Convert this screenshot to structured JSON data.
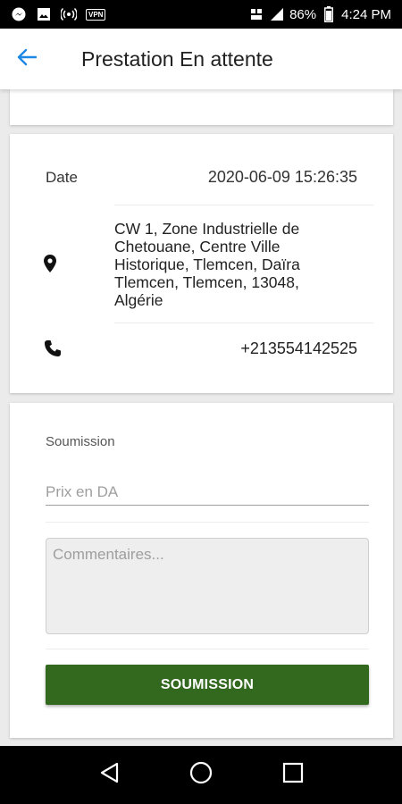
{
  "status_bar": {
    "battery": "86%",
    "time": "4:24 PM",
    "vpn_label": "VPN",
    "icons": [
      "messenger-icon",
      "image-icon",
      "hotspot-icon",
      "vpn-icon",
      "network-icon",
      "signal-icon",
      "battery-icon"
    ]
  },
  "app_bar": {
    "title": "Prestation En attente",
    "back_icon": "arrow-left-icon",
    "accent_color": "#1e88e5"
  },
  "info": {
    "date_label": "Date",
    "date_value": "2020-06-09 15:26:35",
    "address": "CW 1, Zone Industrielle de Chetouane, Centre Ville Historique, Tlemcen, Daïra Tlemcen, Tlemcen, 13048, Algérie",
    "phone": "+213554142525"
  },
  "form": {
    "label": "Soumission",
    "price_placeholder": "Prix en DA",
    "comment_placeholder": "Commentaires...",
    "submit_label": "SOUMISSION",
    "submit_color": "#33691e"
  },
  "nav_bar": {
    "icons": [
      "back-triangle-icon",
      "home-circle-icon",
      "recents-square-icon"
    ]
  }
}
